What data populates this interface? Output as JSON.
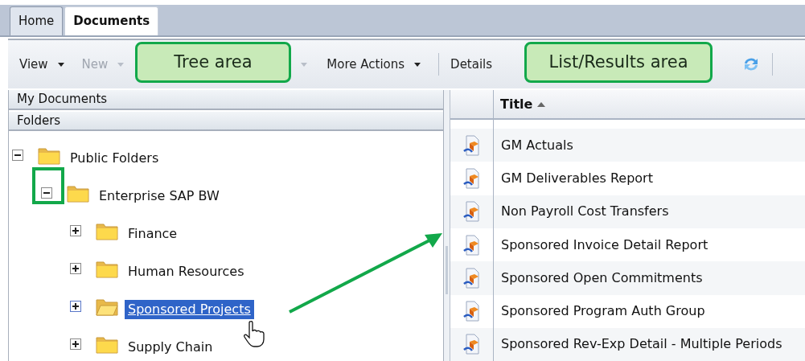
{
  "tabs": [
    {
      "label": "Home",
      "selected": false
    },
    {
      "label": "Documents",
      "selected": true
    }
  ],
  "toolbar": [
    {
      "kind": "menu",
      "label": "View",
      "disabled": false
    },
    {
      "kind": "menu",
      "label": "New",
      "disabled": true
    },
    {
      "kind": "caret",
      "disabled": true
    },
    {
      "kind": "menu",
      "label": "More Actions",
      "disabled": false
    },
    {
      "kind": "separator"
    },
    {
      "kind": "button",
      "label": "Details",
      "disabled": false
    },
    {
      "kind": "refresh"
    },
    {
      "kind": "separator"
    }
  ],
  "left_panel": {
    "headers": [
      "My Documents",
      "Folders"
    ],
    "tree": [
      {
        "label": "Public Folders",
        "expanded": true,
        "selected": false,
        "children": [
          {
            "label": "Enterprise SAP BW",
            "expanded": true,
            "selected": false,
            "highlighted_expander": true,
            "children": [
              {
                "label": "Finance",
                "expanded": false,
                "selected": false
              },
              {
                "label": "Human Resources",
                "expanded": false,
                "selected": false
              },
              {
                "label": "Sponsored Projects",
                "expanded": false,
                "selected": true
              },
              {
                "label": "Supply Chain",
                "expanded": false,
                "selected": false
              }
            ]
          }
        ]
      }
    ]
  },
  "list": {
    "columns": [
      {
        "label": "Title",
        "sorted_ascending": true
      }
    ],
    "rows": [
      "GM Actuals",
      "GM Deliverables Report",
      "Non Payroll Cost Transfers",
      "Sponsored Invoice Detail Report",
      "Sponsored Open Commitments",
      "Sponsored Program Auth Group",
      "Sponsored Rev-Exp Detail - Multiple Periods"
    ]
  },
  "callouts": [
    "Tree area",
    "List/Results area"
  ]
}
